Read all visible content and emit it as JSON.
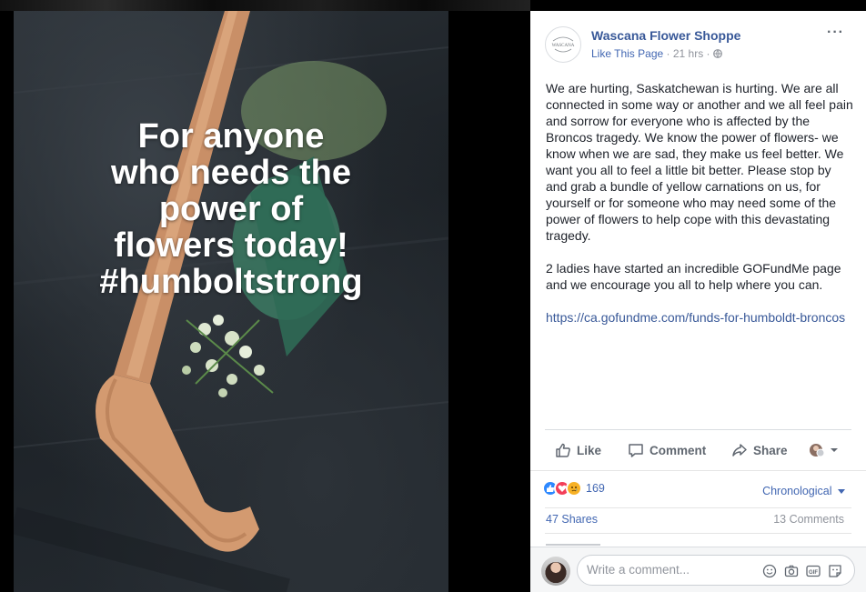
{
  "photo": {
    "overlay_lines": [
      "For anyone",
      "who needs the",
      "power of",
      "flowers today!",
      "#humboltstrong"
    ]
  },
  "post": {
    "page_name": "Wascana Flower Shoppe",
    "like_page": "Like This Page",
    "separator": " · ",
    "time": "21 hrs",
    "more": "···",
    "avatar_text": "WASCANA",
    "paragraph1": "We are hurting, Saskatchewan is hurting. We are all connected in some way or another and we all feel pain and sorrow for everyone who is affected by the Broncos tragedy. We know the power of flowers- we know when we are sad, they make us feel better. We want you all to feel a little bit better. Please stop by and grab a bundle of yellow carnations on us, for yourself or for someone who may need some of the power of flowers to help cope with this devastating tragedy.",
    "paragraph2": "2 ladies have started an incredible GOFundMe page and we encourage you all to help where you can.",
    "link": "https://ca.gofundme.com/funds-for-humboldt-broncos"
  },
  "actions": {
    "like": "Like",
    "comment": "Comment",
    "share": "Share"
  },
  "reactions": {
    "count": "169",
    "sort": "Chronological"
  },
  "stats": {
    "shares": "47 Shares",
    "comments": "13 Comments"
  },
  "composer": {
    "placeholder": "Write a comment..."
  },
  "colors": {
    "accent": "#385898",
    "link": "#4267b2",
    "muted": "#90949c"
  },
  "icons": [
    "like-icon",
    "comment-icon",
    "share-icon",
    "globe-icon",
    "emoji-icon",
    "camera-icon",
    "gif-icon",
    "sticker-icon"
  ]
}
